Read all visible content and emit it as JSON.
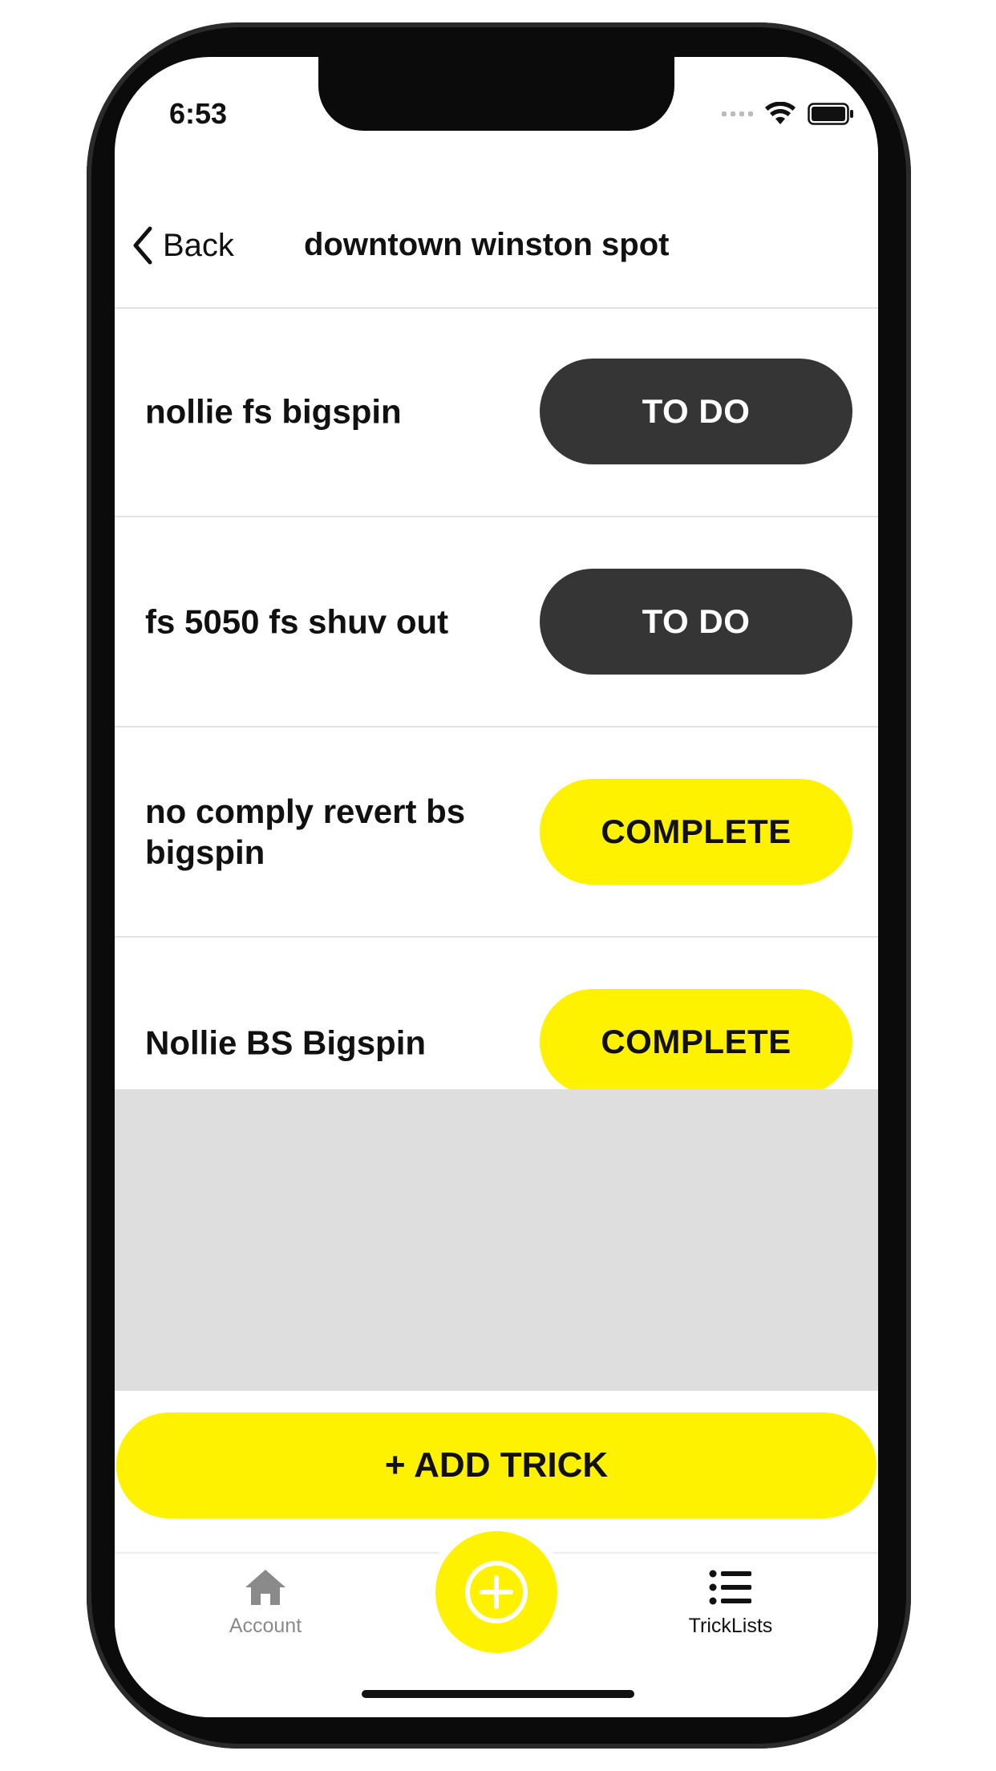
{
  "status_bar": {
    "time": "6:53"
  },
  "navbar": {
    "back_label": "Back",
    "title": "downtown winston spot"
  },
  "tricks": [
    {
      "name": "nollie fs bigspin",
      "status": "TO DO",
      "state": "todo"
    },
    {
      "name": "fs 5050 fs shuv out",
      "status": "TO DO",
      "state": "todo"
    },
    {
      "name": "no comply revert bs bigspin",
      "status": "COMPLETE",
      "state": "complete"
    },
    {
      "name": "Nollie BS Bigspin",
      "status": "COMPLETE",
      "state": "complete"
    }
  ],
  "add_trick_label": "+ ADD TRICK",
  "tabbar": {
    "account_label": "Account",
    "tricklists_label": "TrickLists"
  },
  "colors": {
    "accent_yellow": "#fff200",
    "todo_dark": "#353535",
    "empty_grey": "#dedede"
  },
  "icons": {
    "back": "chevron-left-icon",
    "account": "home-icon",
    "add": "plus-circle-icon",
    "tricklists": "list-icon"
  }
}
